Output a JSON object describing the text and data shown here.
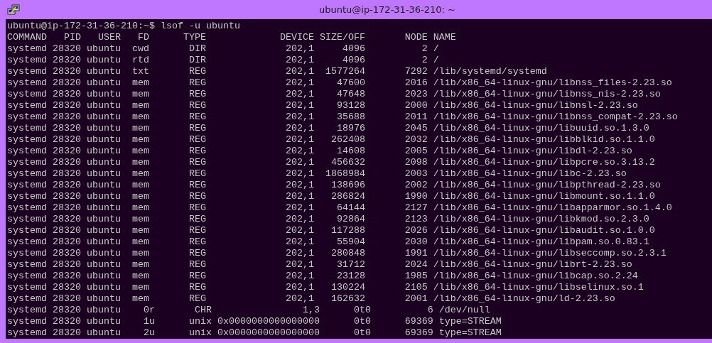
{
  "window": {
    "title": "ubuntu@ip-172-31-36-210: ~"
  },
  "terminal": {
    "lines": [
      "ubuntu@ip-172-31-36-210:~$ lsof -u ubuntu",
      "COMMAND   PID   USER   FD      TYPE             DEVICE SIZE/OFF       NODE NAME",
      "systemd 28320 ubuntu  cwd       DIR              202,1     4096          2 /",
      "systemd 28320 ubuntu  rtd       DIR              202,1     4096          2 /",
      "systemd 28320 ubuntu  txt       REG              202,1  1577264       7292 /lib/systemd/systemd",
      "systemd 28320 ubuntu  mem       REG              202,1    47600       2016 /lib/x86_64-linux-gnu/libnss_files-2.23.so",
      "systemd 28320 ubuntu  mem       REG              202,1    47648       2023 /lib/x86_64-linux-gnu/libnss_nis-2.23.so",
      "systemd 28320 ubuntu  mem       REG              202,1    93128       2000 /lib/x86_64-linux-gnu/libnsl-2.23.so",
      "systemd 28320 ubuntu  mem       REG              202,1    35688       2011 /lib/x86_64-linux-gnu/libnss_compat-2.23.so",
      "systemd 28320 ubuntu  mem       REG              202,1    18976       2045 /lib/x86_64-linux-gnu/libuuid.so.1.3.0",
      "systemd 28320 ubuntu  mem       REG              202,1   262408       2032 /lib/x86_64-linux-gnu/libblkid.so.1.1.0",
      "systemd 28320 ubuntu  mem       REG              202,1    14608       2005 /lib/x86_64-linux-gnu/libdl-2.23.so",
      "systemd 28320 ubuntu  mem       REG              202,1   456632       2098 /lib/x86_64-linux-gnu/libpcre.so.3.13.2",
      "systemd 28320 ubuntu  mem       REG              202,1  1868984       2003 /lib/x86_64-linux-gnu/libc-2.23.so",
      "systemd 28320 ubuntu  mem       REG              202,1   138696       2002 /lib/x86_64-linux-gnu/libpthread-2.23.so",
      "systemd 28320 ubuntu  mem       REG              202,1   286824       1990 /lib/x86_64-linux-gnu/libmount.so.1.1.0",
      "systemd 28320 ubuntu  mem       REG              202,1    64144       2127 /lib/x86_64-linux-gnu/libapparmor.so.1.4.0",
      "systemd 28320 ubuntu  mem       REG              202,1    92864       2123 /lib/x86_64-linux-gnu/libkmod.so.2.3.0",
      "systemd 28320 ubuntu  mem       REG              202,1   117288       2026 /lib/x86_64-linux-gnu/libaudit.so.1.0.0",
      "systemd 28320 ubuntu  mem       REG              202,1    55904       2030 /lib/x86_64-linux-gnu/libpam.so.0.83.1",
      "systemd 28320 ubuntu  mem       REG              202,1   280848       1991 /lib/x86_64-linux-gnu/libseccomp.so.2.3.1",
      "systemd 28320 ubuntu  mem       REG              202,1    31712       2024 /lib/x86_64-linux-gnu/librt-2.23.so",
      "systemd 28320 ubuntu  mem       REG              202,1    23128       1985 /lib/x86_64-linux-gnu/libcap.so.2.24",
      "systemd 28320 ubuntu  mem       REG              202,1   130224       2105 /lib/x86_64-linux-gnu/libselinux.so.1",
      "systemd 28320 ubuntu  mem       REG              202,1   162632       2001 /lib/x86_64-linux-gnu/ld-2.23.so",
      "systemd 28320 ubuntu    0r       CHR                1,3      0t0          6 /dev/null",
      "systemd 28320 ubuntu    1u      unix 0x0000000000000000      0t0      69369 type=STREAM",
      "systemd 28320 ubuntu    2u      unix 0x0000000000000000      0t0      69369 type=STREAM"
    ]
  }
}
